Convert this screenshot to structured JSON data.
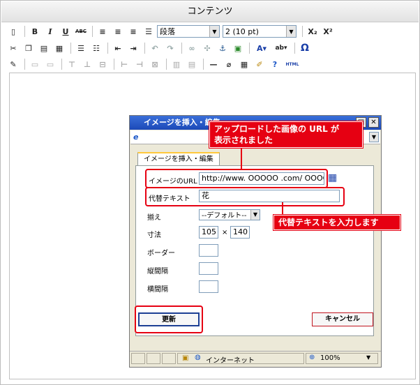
{
  "window": {
    "title": "コンテンツ"
  },
  "toolbar": {
    "format_value": "段落",
    "fontsize_value": "2 (10 pt)",
    "subscript_label": "X₂",
    "superscript_label": "X²",
    "html_label": "HTML",
    "omega_label": "Ω",
    "bold": "B",
    "italic": "I",
    "underline": "U",
    "strike": "ABC"
  },
  "dialog": {
    "title": "イメージを挿入・編集",
    "tab": "イメージを挿入・編集",
    "url_label": "イメージのURL",
    "url_value": "http://www. OOOOO .com/ OOOO",
    "alt_label": "代替テキスト",
    "alt_value": "花",
    "align_label": "揃え",
    "align_value": "--デフォルト--",
    "size_label": "寸法",
    "width_value": "105",
    "size_sep": "×",
    "height_value": "140",
    "border_label": "ボーダー",
    "vspace_label": "縦間隔",
    "hspace_label": "横間隔",
    "update_button": "更新",
    "cancel_button": "キャンセル"
  },
  "statusbar": {
    "zone": "インターネット",
    "zoom": "100%"
  },
  "annotations": {
    "url_note_1": "アップロードした画像の URL が",
    "url_note_2": "表示されました",
    "alt_note": "代替テキストを入力します"
  },
  "colors": {
    "annotation": "#e60012",
    "dialog_title": "#2a5fcf"
  }
}
